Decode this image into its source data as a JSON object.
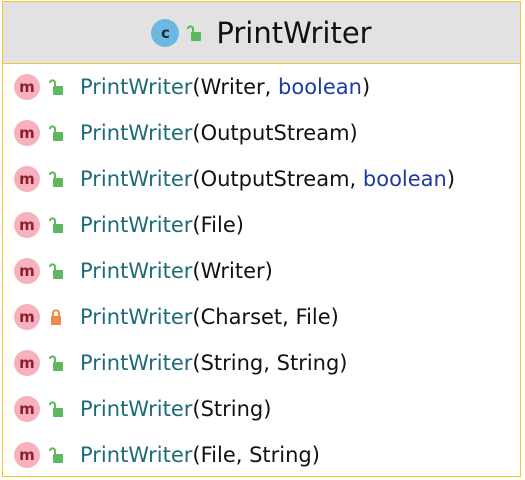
{
  "header": {
    "title": "PrintWriter",
    "class_icon_letter": "c"
  },
  "colors": {
    "border": "#f0c829",
    "header_bg": "#e2e2e2",
    "method_name": "#1d6b7a",
    "keyword": "#1f3aa6",
    "public_lock": "#5cb85c",
    "private_lock": "#ef8a4a"
  },
  "methods": [
    {
      "icon_letter": "m",
      "visibility": "public",
      "name": "PrintWriter",
      "open": "(",
      "params": [
        {
          "text": "Writer",
          "keyword": false
        },
        {
          "text": "boolean",
          "keyword": true
        }
      ],
      "close": ")"
    },
    {
      "icon_letter": "m",
      "visibility": "public",
      "name": "PrintWriter",
      "open": "(",
      "params": [
        {
          "text": "OutputStream",
          "keyword": false
        }
      ],
      "close": ")"
    },
    {
      "icon_letter": "m",
      "visibility": "public",
      "name": "PrintWriter",
      "open": "(",
      "params": [
        {
          "text": "OutputStream",
          "keyword": false
        },
        {
          "text": "boolean",
          "keyword": true
        }
      ],
      "close": ")"
    },
    {
      "icon_letter": "m",
      "visibility": "public",
      "name": "PrintWriter",
      "open": "(",
      "params": [
        {
          "text": "File",
          "keyword": false
        }
      ],
      "close": ")"
    },
    {
      "icon_letter": "m",
      "visibility": "public",
      "name": "PrintWriter",
      "open": "(",
      "params": [
        {
          "text": "Writer",
          "keyword": false
        }
      ],
      "close": ")"
    },
    {
      "icon_letter": "m",
      "visibility": "private",
      "name": "PrintWriter",
      "open": "(",
      "params": [
        {
          "text": "Charset",
          "keyword": false
        },
        {
          "text": "File",
          "keyword": false
        }
      ],
      "close": ")"
    },
    {
      "icon_letter": "m",
      "visibility": "public",
      "name": "PrintWriter",
      "open": "(",
      "params": [
        {
          "text": "String",
          "keyword": false
        },
        {
          "text": "String",
          "keyword": false
        }
      ],
      "close": ")"
    },
    {
      "icon_letter": "m",
      "visibility": "public",
      "name": "PrintWriter",
      "open": "(",
      "params": [
        {
          "text": "String",
          "keyword": false
        }
      ],
      "close": ")"
    },
    {
      "icon_letter": "m",
      "visibility": "public",
      "name": "PrintWriter",
      "open": "(",
      "params": [
        {
          "text": "File",
          "keyword": false
        },
        {
          "text": "String",
          "keyword": false
        }
      ],
      "close": ")"
    }
  ],
  "separator": ", "
}
